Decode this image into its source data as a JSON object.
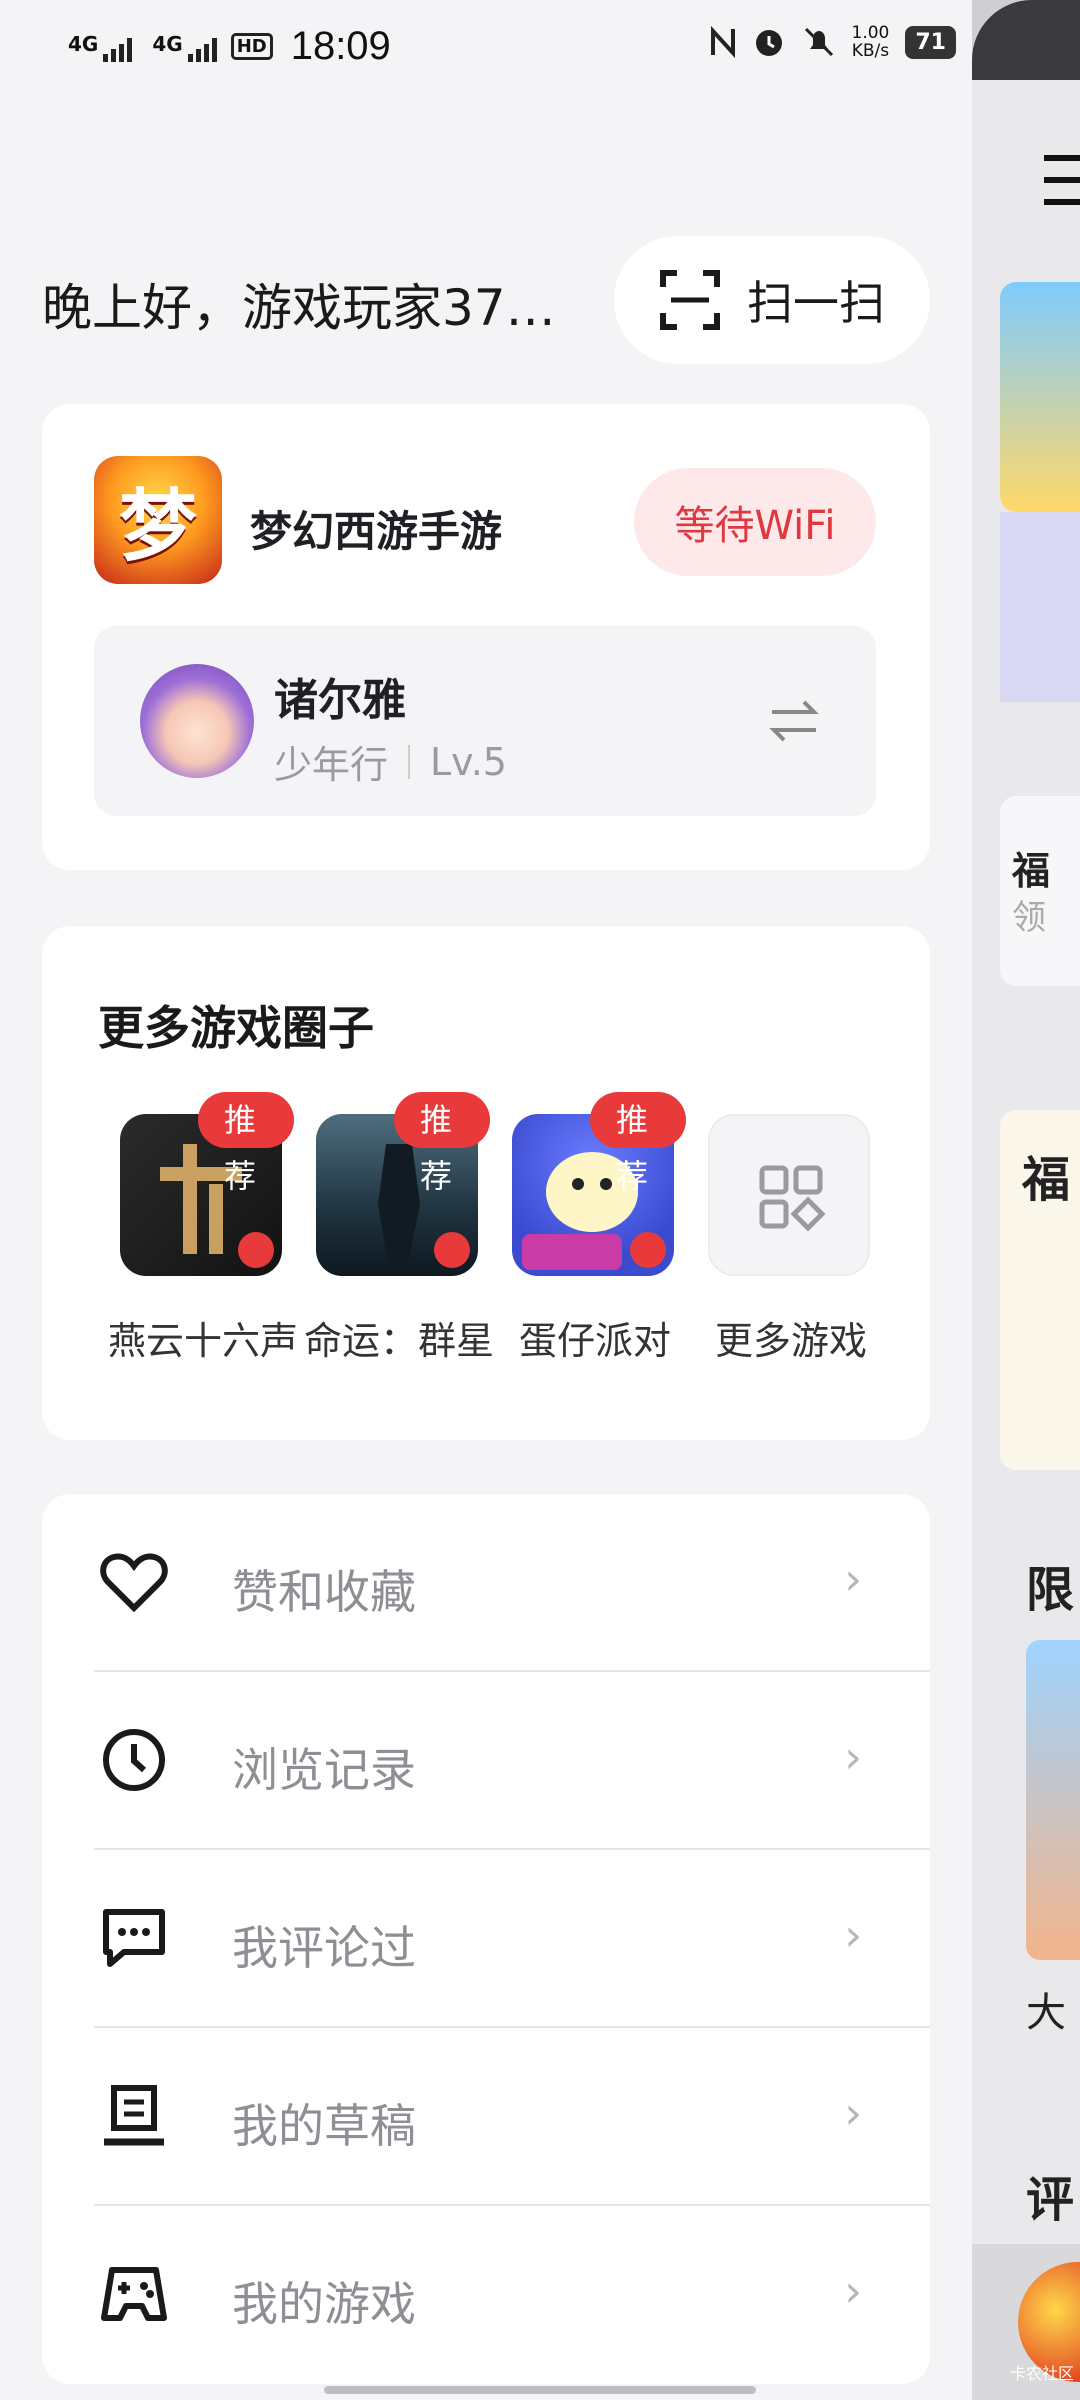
{
  "status_bar": {
    "signal1": "4G",
    "signal2": "4G",
    "hd": "HD",
    "time": "18:09",
    "net_speed": "1.00",
    "net_unit": "KB/s",
    "battery": "71"
  },
  "header": {
    "greeting": "晚上好，游戏玩家37…",
    "scan_label": "扫一扫"
  },
  "game_card": {
    "icon_char": "梦",
    "game_name": "梦幻西游手游",
    "wifi_label": "等待WiFi",
    "role_name": "诸尔雅",
    "server": "少年行",
    "level": "Lv.5"
  },
  "circles": {
    "title": "更多游戏圈子",
    "items": [
      {
        "label": "燕云十六声",
        "tag": "推荐"
      },
      {
        "label": "命运：群星",
        "tag": "推荐"
      },
      {
        "label": "蛋仔派对",
        "tag": "推荐"
      },
      {
        "label": "更多游戏"
      }
    ]
  },
  "menu": {
    "items": [
      {
        "label": "赞和收藏",
        "icon": "heart-icon"
      },
      {
        "label": "浏览记录",
        "icon": "clock-icon"
      },
      {
        "label": "我评论过",
        "icon": "comment-icon"
      },
      {
        "label": "我的草稿",
        "icon": "draft-icon"
      },
      {
        "label": "我的游戏",
        "icon": "gamepad-icon"
      }
    ]
  },
  "peek": {
    "t1": "福",
    "t2": "领",
    "t3": "福",
    "t4": "限",
    "t5": "大",
    "t6": "评",
    "watermark": "卡农社区"
  },
  "colors": {
    "accent_red": "#e83a3a",
    "wifi_bg": "#fde9ea",
    "background": "#f4f4f6"
  }
}
